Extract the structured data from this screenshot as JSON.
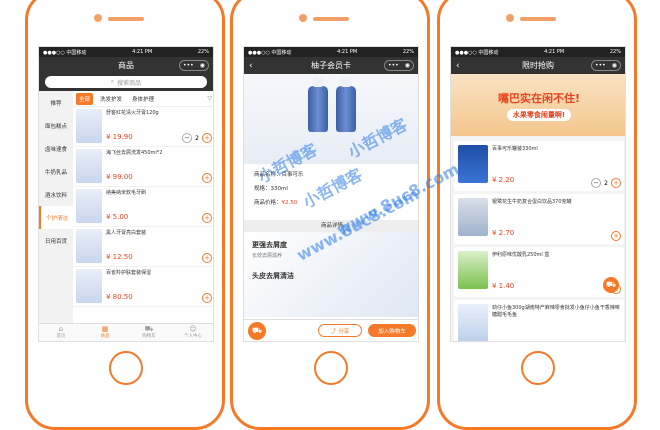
{
  "status": {
    "carrier": "●●●○○ 中国移动",
    "time": "4:21 PM",
    "battery": "22%"
  },
  "capsule": {
    "dots": "•••",
    "circle": "◉"
  },
  "screen1": {
    "title": "商品",
    "search_placeholder": "搜索商品",
    "categories": [
      "推荐",
      "面包糕点",
      "卤味速食",
      "牛奶乳品",
      "酒水饮料",
      "个护清洁",
      "日用百货"
    ],
    "subtabs": [
      "全部",
      "洗发护发",
      "身体护理"
    ],
    "products": [
      {
        "name": "舒客红花清火牙膏120g",
        "price": "¥ 19.90",
        "qty": "2"
      },
      {
        "name": "海飞丝去屑洗发450ml*2",
        "price": "¥ 99.00",
        "qty": ""
      },
      {
        "name": "纳美纳米软毛牙刷",
        "price": "¥ 5.00",
        "qty": ""
      },
      {
        "name": "黑人牙膏亮白套装",
        "price": "¥ 12.50",
        "qty": ""
      },
      {
        "name": "百雀羚护肤套装保湿",
        "price": "¥ 80.50",
        "qty": ""
      }
    ],
    "tabbar": [
      "首页",
      "商品",
      "购物车",
      "个人中心"
    ]
  },
  "screen2": {
    "title": "柚子会员卡",
    "brand_label": "商品名称：",
    "brand_value": "百事可乐",
    "spec_label": "规格：",
    "spec_value": "330ml",
    "price_label": "商品价格：",
    "price_value": "¥2.50",
    "detail_header": "商品详情",
    "banner_title": "更强去屑度",
    "banner_sub": "长效去屑滋养",
    "banner_extra": "头皮去屑清洁",
    "share": "分享",
    "add_to_cart": "加入购物车"
  },
  "screen3": {
    "title": "限时抢购",
    "banner_main": "嘴巴实在闲不住!",
    "banner_sub": "水果零食闹量啊!",
    "products": [
      {
        "name": "百事可乐罐装330ml",
        "price": "¥ 2.20",
        "qty": "2"
      },
      {
        "name": "银鹭花生牛奶复合蛋白饮品370克罐",
        "price": "¥ 2.70",
        "qty": ""
      },
      {
        "name": "伊利原味优酸乳250ml 盒",
        "price": "¥ 1.40",
        "qty": ""
      },
      {
        "name": "劲仔小鱼300g湖南特产麻辣零食批发小鱼仔小鱼干香辣味糖醋毛毛鱼",
        "price": "",
        "qty": ""
      }
    ]
  },
  "watermark": {
    "cn": "小哲博客",
    "url": "www.8uc8.com"
  },
  "colors": {
    "accent": "#f47a2a",
    "price": "#e8431d",
    "watermark": "#2f7ee9"
  }
}
